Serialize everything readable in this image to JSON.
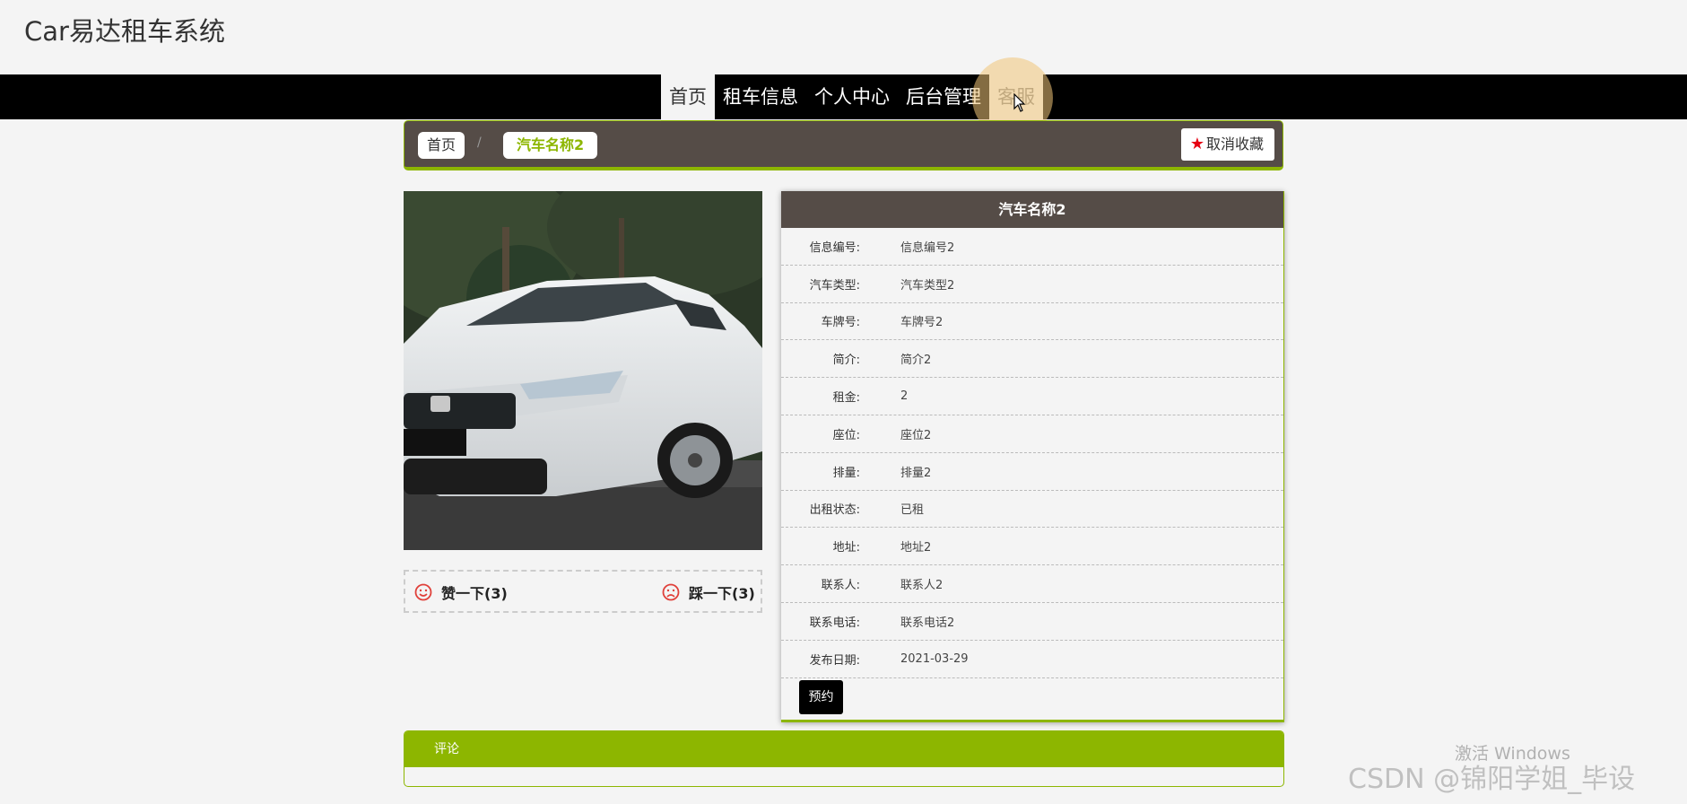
{
  "site": {
    "title": "Car易达租车系统"
  },
  "nav": {
    "items": [
      "首页",
      "租车信息",
      "个人中心",
      "后台管理",
      "客服"
    ],
    "active_index": 0
  },
  "breadcrumb": {
    "home": "首页",
    "separator": "/",
    "current": "汽车名称2"
  },
  "favorite": {
    "label": "取消收藏",
    "icon": "star-icon",
    "color": "#e60012"
  },
  "votes": {
    "up": {
      "label": "赞一下(3)",
      "icon": "smile-icon"
    },
    "down": {
      "label": "踩一下(3)",
      "icon": "frown-icon"
    }
  },
  "details": {
    "title": "汽车名称2",
    "rows": [
      {
        "label": "信息编号:",
        "value": "信息编号2"
      },
      {
        "label": "汽车类型:",
        "value": "汽车类型2"
      },
      {
        "label": "车牌号:",
        "value": "车牌号2"
      },
      {
        "label": "简介:",
        "value": "简介2"
      },
      {
        "label": "租金:",
        "value": "2"
      },
      {
        "label": "座位:",
        "value": "座位2"
      },
      {
        "label": "排量:",
        "value": "排量2"
      },
      {
        "label": "出租状态:",
        "value": "已租"
      },
      {
        "label": "地址:",
        "value": "地址2"
      },
      {
        "label": "联系人:",
        "value": "联系人2"
      },
      {
        "label": "联系电话:",
        "value": "联系电话2"
      },
      {
        "label": "发布日期:",
        "value": "2021-03-29"
      }
    ],
    "book_label": "预约"
  },
  "comments": {
    "title": "评论"
  },
  "overlay": {
    "activate_windows": "激活 Windows",
    "watermark": "CSDN @锦阳学姐_毕设"
  },
  "colors": {
    "accent": "#8db600",
    "header_bg": "#554c47",
    "nav_bg": "#000000"
  }
}
